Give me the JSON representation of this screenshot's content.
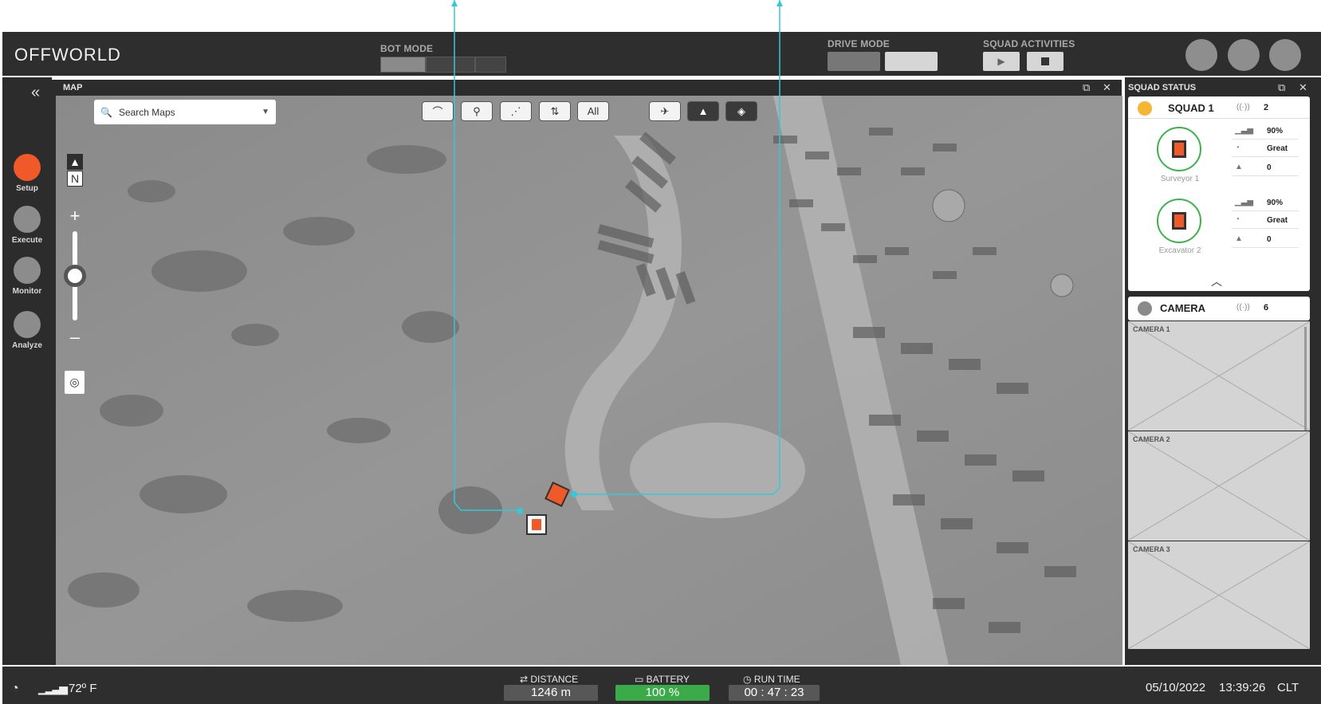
{
  "header": {
    "logo": "OFFWORLD",
    "bot_mode_label": "BOT MODE",
    "drive_mode_label": "DRIVE MODE",
    "squad_activities_label": "SQUAD ACTIVITIES",
    "play_icon": "play-icon",
    "stop_icon": "stop-icon"
  },
  "rail": {
    "collapse_icon": "double-chevron-left-icon",
    "items": [
      {
        "label": "Setup",
        "active": true
      },
      {
        "label": "Execute",
        "active": false
      },
      {
        "label": "Monitor",
        "active": false
      },
      {
        "label": "Analyze",
        "active": false
      }
    ]
  },
  "map": {
    "title": "MAP",
    "search_placeholder": "Search Maps",
    "filter_all": "All",
    "north_label": "N",
    "zoom_in": "+",
    "zoom_out": "–",
    "zoom_fraction": 0.5
  },
  "squad": {
    "title": "SQUAD STATUS",
    "name": "SQUAD 1",
    "status_color": "#f5b731",
    "count": "2",
    "bots": [
      {
        "name": "Surveyor 1",
        "signal": "90%",
        "gps": "Great",
        "alerts": "0"
      },
      {
        "name": "Excavator 2",
        "signal": "90%",
        "gps": "Great",
        "alerts": "0"
      }
    ]
  },
  "camera": {
    "name": "CAMERA",
    "status_color": "#8a8a8a",
    "count": "6",
    "cells": [
      "CAMERA 1",
      "CAMERA 2",
      "CAMERA 3"
    ]
  },
  "footer": {
    "temperature": "72º F",
    "distance_label": "DISTANCE",
    "distance_value": "1246 m",
    "battery_label": "BATTERY",
    "battery_value": "100 %",
    "runtime_label": "RUN TIME",
    "runtime_value": "00 : 47 : 23",
    "date": "05/10/2022",
    "time": "13:39:26",
    "tz": "CLT"
  },
  "colors": {
    "accent": "#f05a28",
    "path": "#35c8d8",
    "ok": "#3cb34a"
  }
}
